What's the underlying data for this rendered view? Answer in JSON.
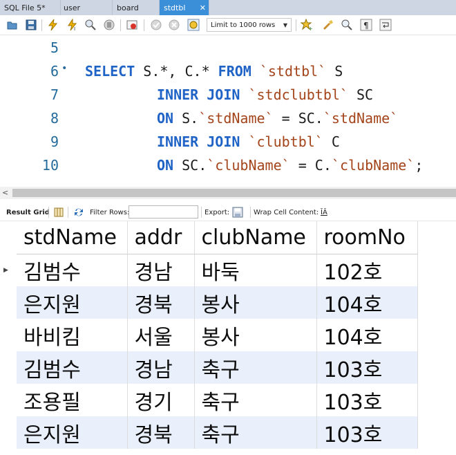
{
  "tabs": [
    {
      "label": "SQL File 5*",
      "active": false
    },
    {
      "label": "user",
      "active": false
    },
    {
      "label": "board",
      "active": false
    },
    {
      "label": "stdtbl",
      "active": true
    }
  ],
  "toolbar": {
    "limit_label": "Limit to 1000 rows",
    "icons": [
      "folder-open-icon",
      "save-icon",
      "execute-icon",
      "execute-current-icon",
      "explain-icon",
      "stop-icon",
      "toggle-error-icon",
      "commit-icon",
      "rollback-icon",
      "autocommit-icon",
      "beautify-icon",
      "snippet-icon",
      "find-icon",
      "invisible-chars-icon",
      "wrap-icon"
    ]
  },
  "editor": {
    "lines": [
      {
        "num": "5",
        "marker": "",
        "parts": []
      },
      {
        "num": "6",
        "marker": "•",
        "parts": [
          {
            "t": "kw",
            "v": "SELECT"
          },
          {
            "t": "p",
            "v": " S.*, C.* "
          },
          {
            "t": "kw",
            "v": "FROM"
          },
          {
            "t": "p",
            "v": " "
          },
          {
            "t": "id",
            "v": "`stdtbl`"
          },
          {
            "t": "p",
            "v": " S"
          }
        ]
      },
      {
        "num": "7",
        "marker": "",
        "parts": [
          {
            "t": "kw",
            "v": "INNER JOIN"
          },
          {
            "t": "p",
            "v": " "
          },
          {
            "t": "id",
            "v": "`stdclubtbl`"
          },
          {
            "t": "p",
            "v": " SC"
          }
        ]
      },
      {
        "num": "8",
        "marker": "",
        "parts": [
          {
            "t": "kw",
            "v": "ON"
          },
          {
            "t": "p",
            "v": " S."
          },
          {
            "t": "id",
            "v": "`stdName`"
          },
          {
            "t": "p",
            "v": " = SC."
          },
          {
            "t": "id",
            "v": "`stdName`"
          }
        ]
      },
      {
        "num": "9",
        "marker": "",
        "parts": [
          {
            "t": "kw",
            "v": "INNER JOIN"
          },
          {
            "t": "p",
            "v": " "
          },
          {
            "t": "id",
            "v": "`clubtbl`"
          },
          {
            "t": "p",
            "v": " C"
          }
        ]
      },
      {
        "num": "10",
        "marker": "",
        "parts": [
          {
            "t": "kw",
            "v": "ON"
          },
          {
            "t": "p",
            "v": " SC."
          },
          {
            "t": "id",
            "v": "`clubName`"
          },
          {
            "t": "p",
            "v": " = C."
          },
          {
            "t": "id",
            "v": "`clubName`"
          },
          {
            "t": "p",
            "v": ";"
          }
        ]
      }
    ]
  },
  "result_toolbar": {
    "result_grid": "Result Grid",
    "filter_rows": "Filter Rows:",
    "export": "Export:",
    "wrap_cell": "Wrap Cell Content:",
    "wrap_glyph": "ĪĀ"
  },
  "grid": {
    "columns": [
      "stdName",
      "addr",
      "clubName",
      "roomNo"
    ],
    "rows": [
      [
        "김범수",
        "경남",
        "바둑",
        "102호"
      ],
      [
        "은지원",
        "경북",
        "봉사",
        "104호"
      ],
      [
        "바비킴",
        "서울",
        "봉사",
        "104호"
      ],
      [
        "김범수",
        "경남",
        "축구",
        "103호"
      ],
      [
        "조용필",
        "경기",
        "축구",
        "103호"
      ],
      [
        "은지원",
        "경북",
        "축구",
        "103호"
      ]
    ]
  }
}
